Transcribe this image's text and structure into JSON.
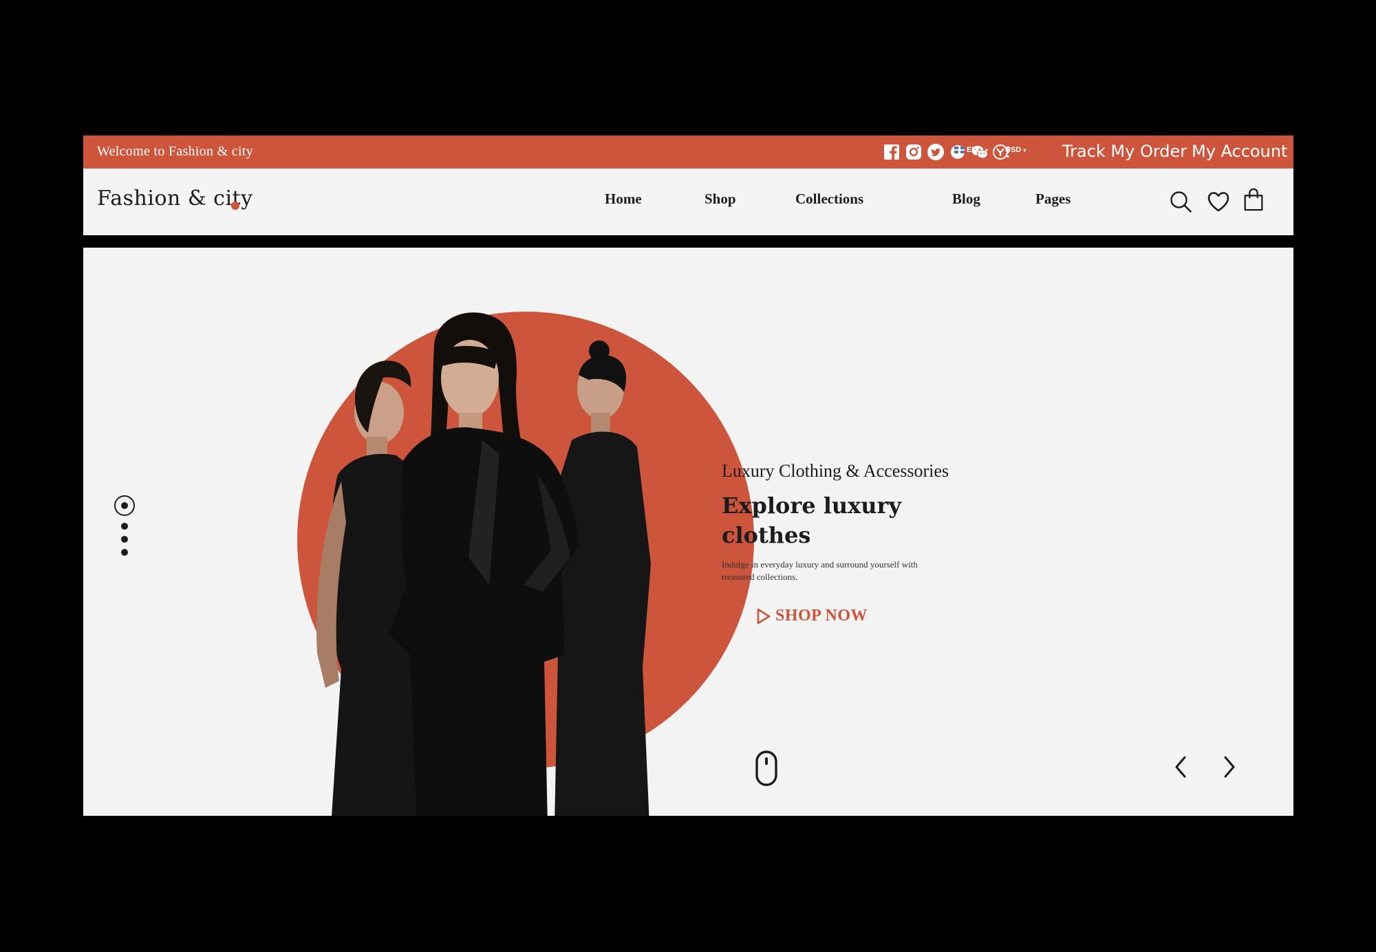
{
  "topbar": {
    "welcome": "Welcome to Fashion & city",
    "social_icons": [
      "facebook-icon",
      "instagram-icon",
      "twitter-icon",
      "google-icon",
      "wechat-icon",
      "yahoo-icon"
    ],
    "language": "ENG",
    "currency": "USD",
    "track_order": "Track My Order",
    "my_account": "My Account"
  },
  "header": {
    "logo": "Fashion & city",
    "nav": [
      "Home",
      "Shop",
      "Collections",
      "Blog",
      "Pages"
    ],
    "icons": [
      "search-icon",
      "heart-icon",
      "shopping-bag-icon"
    ]
  },
  "hero": {
    "subtitle": "Luxury Clothing & Accessories",
    "headline": "Explore luxury clothes",
    "description": "Indulge in everyday luxury and surround yourself with treasured collections.",
    "cta": "SHOP NOW",
    "slide_count": 4,
    "active_slide": 1
  },
  "colors": {
    "accent": "#cd553c",
    "text": "#1c1c1c",
    "hero_background": "#f3f3f3",
    "header_background": "#f4f4f4",
    "frame": "#000000"
  }
}
